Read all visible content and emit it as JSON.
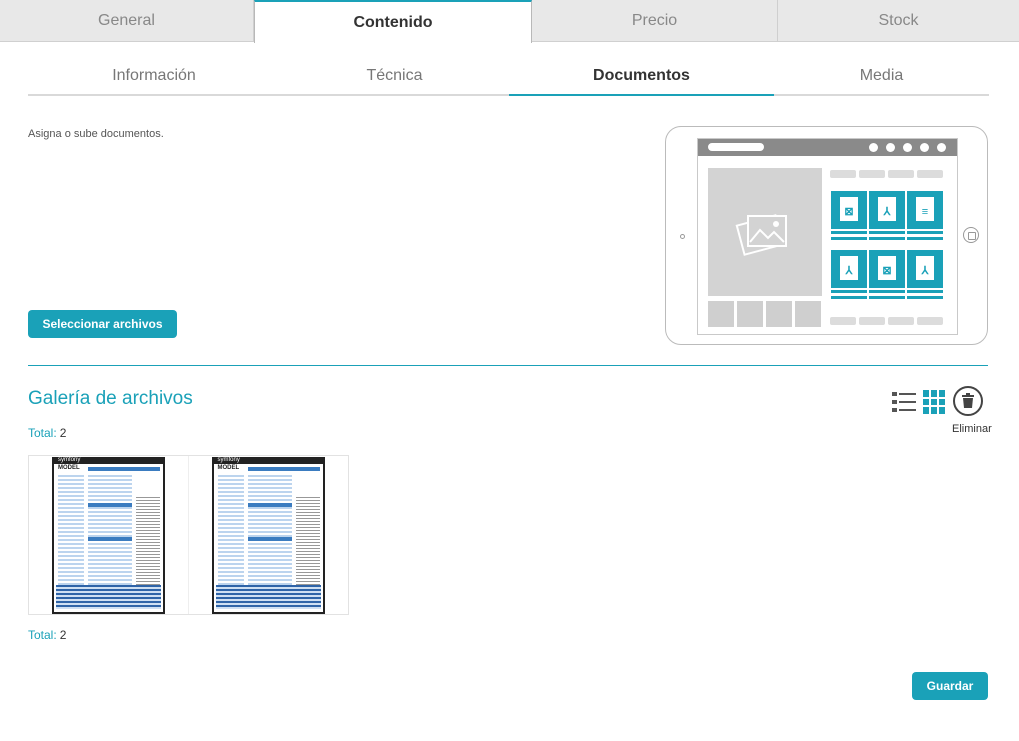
{
  "top_tabs": [
    {
      "label": "General",
      "active": false
    },
    {
      "label": "Contenido",
      "active": true
    },
    {
      "label": "Precio",
      "active": false
    },
    {
      "label": "Stock",
      "active": false
    }
  ],
  "sub_tabs": [
    {
      "label": "Información",
      "active": false
    },
    {
      "label": "Técnica",
      "active": false
    },
    {
      "label": "Documentos",
      "active": true
    },
    {
      "label": "Media",
      "active": false
    }
  ],
  "upload": {
    "hint": "Asigna o sube documentos.",
    "select_button": "Seleccionar archivos"
  },
  "gallery": {
    "title": "Galería de archivos",
    "total_label": "Total:",
    "total_value": "2",
    "view_icons": [
      "list-view-icon",
      "grid-view-icon"
    ],
    "delete_icon": "trash-icon",
    "delete_label": "Eliminar",
    "files": [
      {
        "brand": "symfony",
        "heading": "MODEL"
      },
      {
        "brand": "symfony",
        "heading": "MODEL"
      }
    ]
  },
  "actions": {
    "save_button": "Guardar"
  },
  "colors": {
    "accent": "#1aa1b8",
    "tab_bg": "#e8e8e8"
  }
}
